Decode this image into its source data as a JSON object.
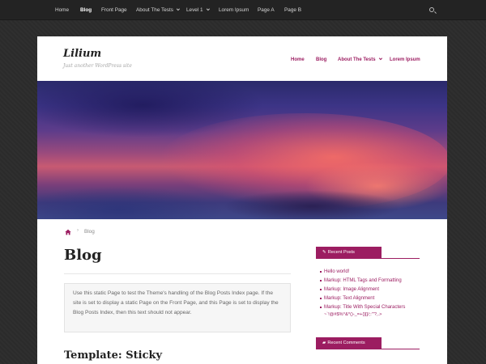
{
  "topnav": {
    "items": [
      {
        "label": "Home"
      },
      {
        "label": "Blog",
        "active": true
      },
      {
        "label": "Front Page"
      },
      {
        "label": "About The Tests",
        "has_dropdown": true
      },
      {
        "label": "Level 1",
        "has_dropdown": true
      },
      {
        "label": "Lorem Ipsum"
      },
      {
        "label": "Page A"
      },
      {
        "label": "Page B"
      }
    ],
    "search_icon": "search-icon"
  },
  "site": {
    "title": "Lilium",
    "tagline": "Just another WordPress site"
  },
  "mainnav": {
    "items": [
      {
        "label": "Home"
      },
      {
        "label": "Blog"
      },
      {
        "label": "About The Tests",
        "has_dropdown": true
      },
      {
        "label": "Lorem Ipsum"
      }
    ]
  },
  "breadcrumb": {
    "home_icon": "home-icon",
    "separator": "›",
    "current": "Blog"
  },
  "content": {
    "page_title": "Blog",
    "intro": "Use this static Page to test the Theme's handling of the Blog Posts Index page. If the site is set to display a static Page on the Front Page, and this Page is set to display the Blog Posts Index, then this text should not appear.",
    "post_title": "Template: Sticky"
  },
  "sidebar": {
    "recent_posts": {
      "title": "Recent Posts",
      "icon": "pencil-icon",
      "items": [
        "Hello world!",
        "Markup: HTML Tags and Formatting",
        "Markup: Image Alignment",
        "Markup: Text Alignment",
        "Markup: Title With Special Characters"
      ],
      "last_item_continuation": "~`!@#$%^&*()-_=+{}[]/;:'\"?,.>"
    },
    "recent_comments": {
      "title": "Recent Comments",
      "icon": "comment-icon"
    }
  },
  "colors": {
    "accent": "#9c1d61",
    "background": "#2b2b2b",
    "topbar": "#232323",
    "card": "#ffffff"
  }
}
